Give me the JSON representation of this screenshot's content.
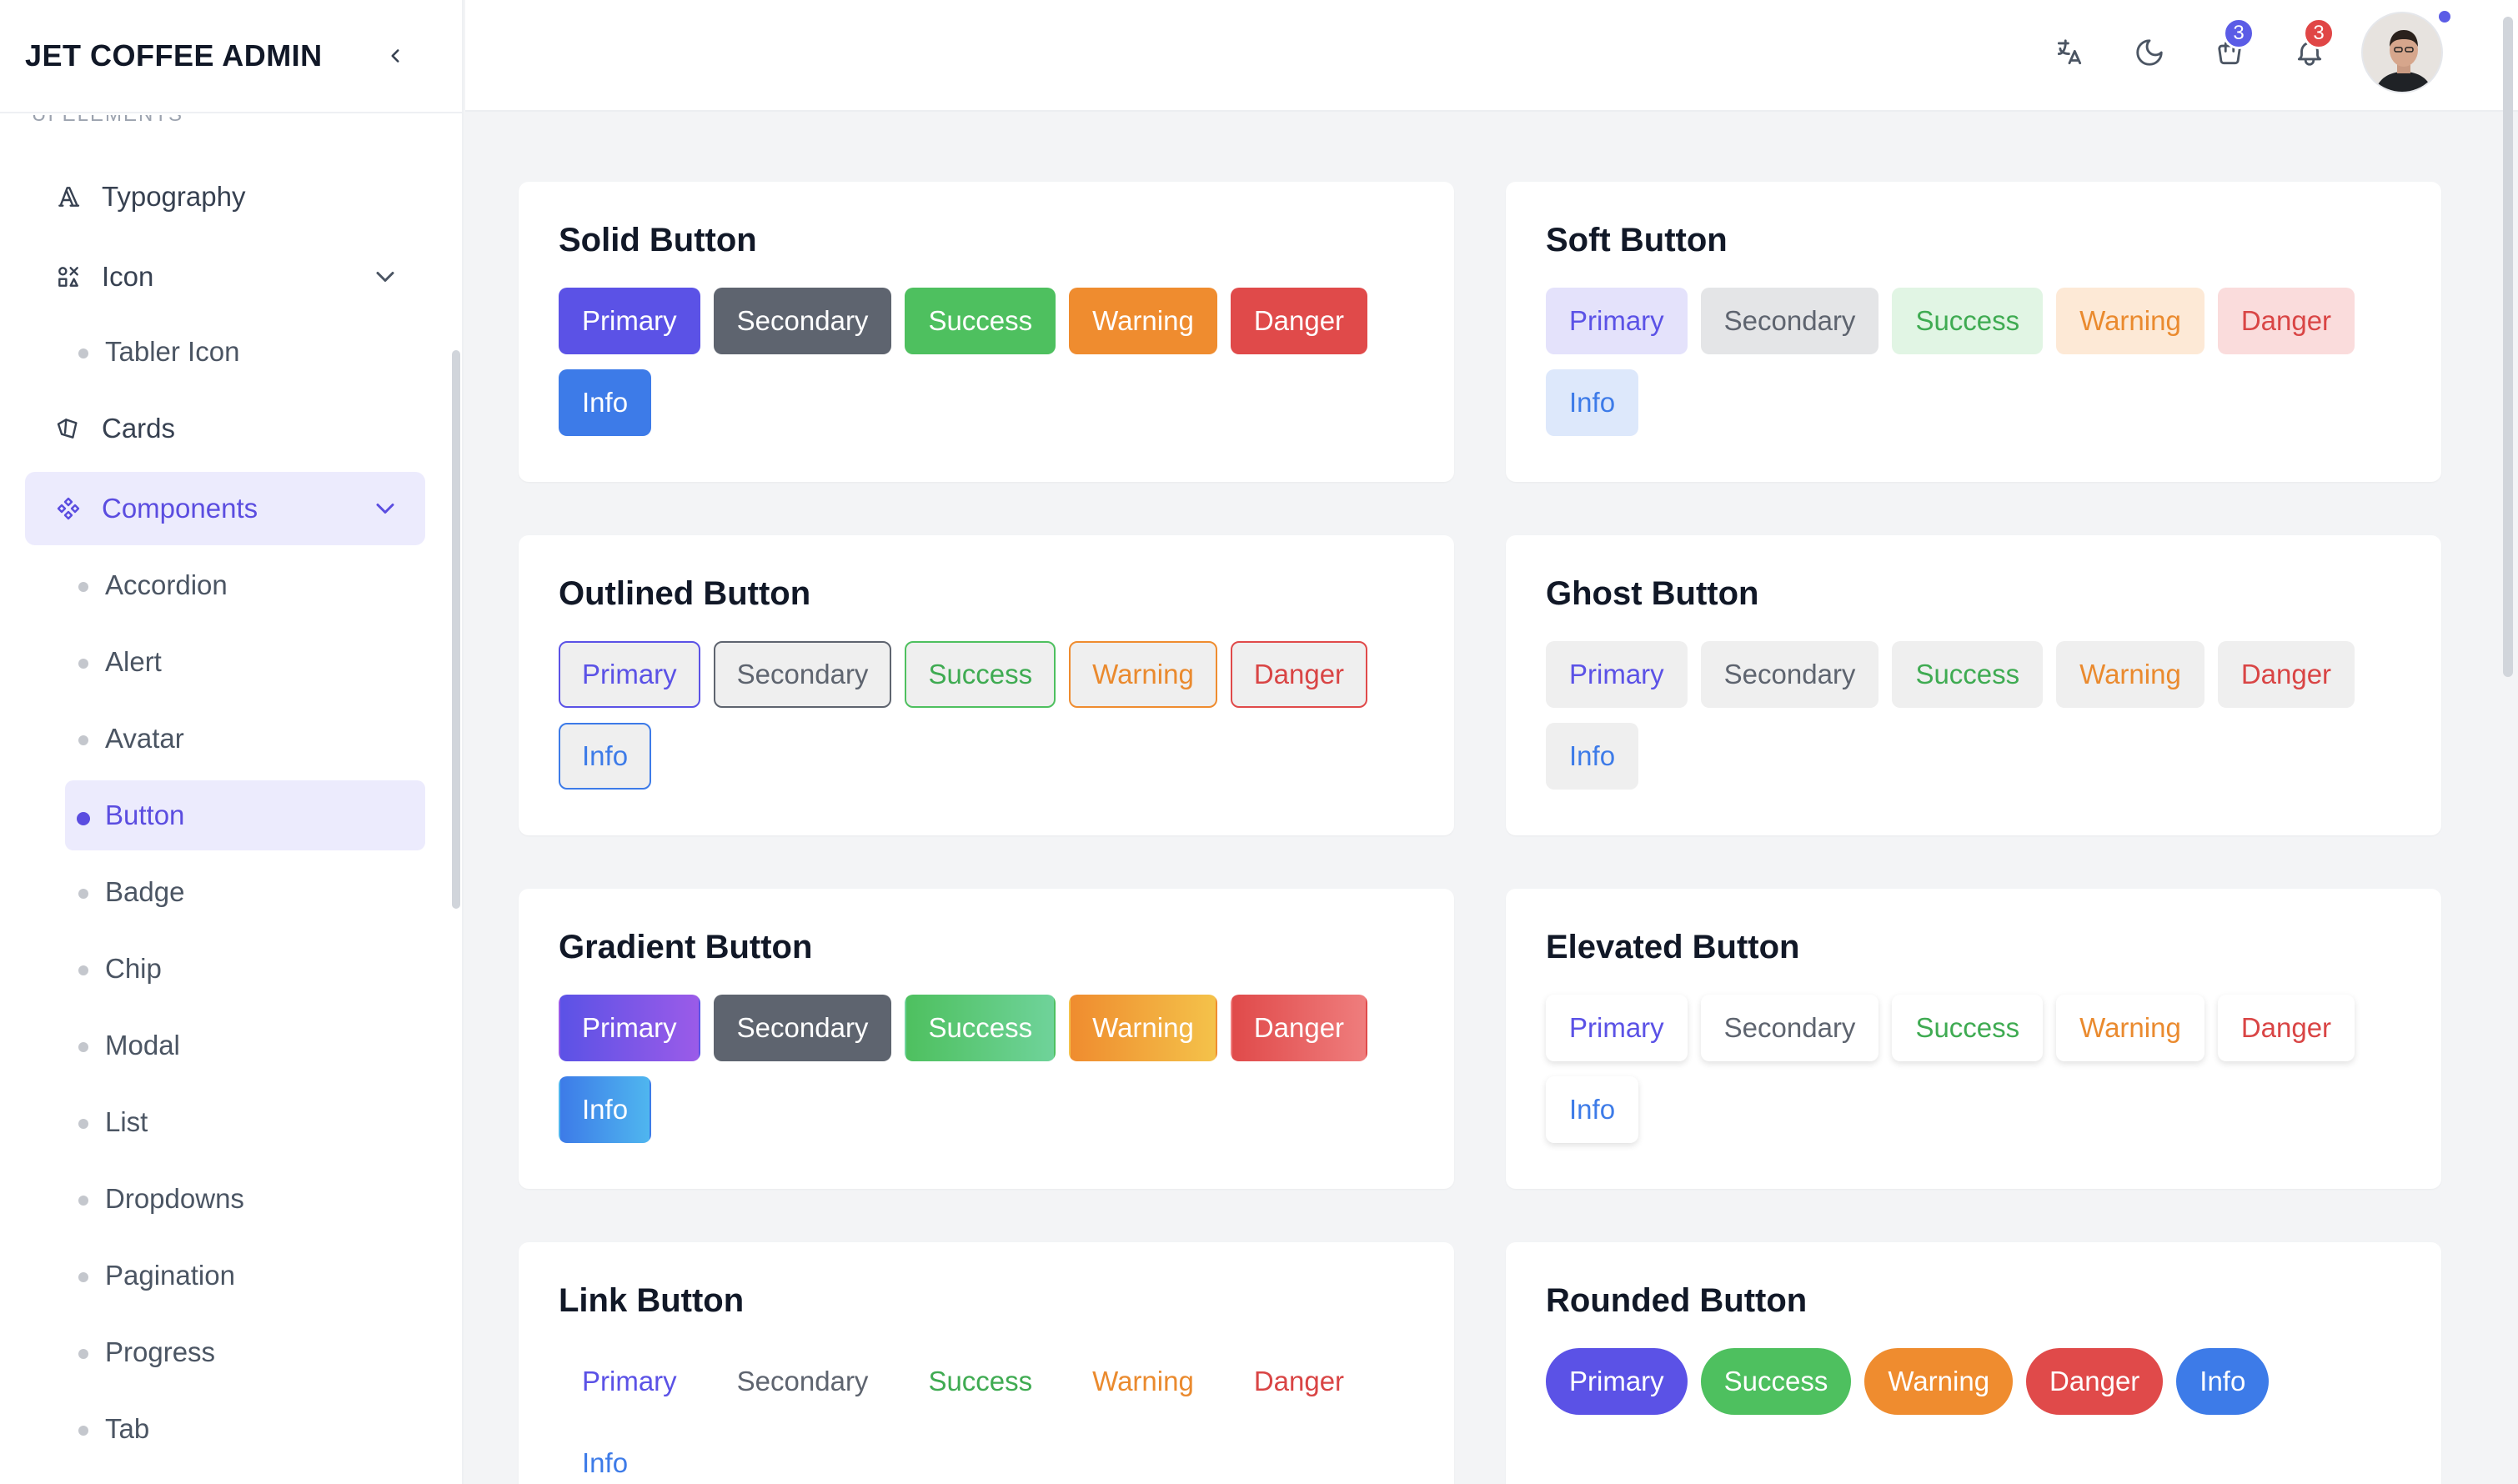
{
  "app": {
    "brand": "JET COFFEE ADMIN"
  },
  "sidebar": {
    "section_label": "UI ELEMENTS",
    "items": [
      {
        "label": "Typography",
        "icon": "typography-icon"
      },
      {
        "label": "Icon",
        "icon": "icons-grid-icon"
      },
      {
        "label": "Tabler Icon"
      },
      {
        "label": "Cards",
        "icon": "cards-icon"
      },
      {
        "label": "Components",
        "icon": "components-icon"
      }
    ],
    "components_sub": [
      "Accordion",
      "Alert",
      "Avatar",
      "Button",
      "Badge",
      "Chip",
      "Modal",
      "List",
      "Dropdowns",
      "Pagination",
      "Progress",
      "Tab"
    ]
  },
  "topbar": {
    "cart_count": "3",
    "notification_count": "3"
  },
  "labels": {
    "primary": "Primary",
    "secondary": "Secondary",
    "success": "Success",
    "warning": "Warning",
    "danger": "Danger",
    "info": "Info"
  },
  "cards": {
    "solid": "Solid Button",
    "soft": "Soft Button",
    "outlined": "Outlined Button",
    "ghost": "Ghost Button",
    "gradient": "Gradient Button",
    "elevated": "Elevated Button",
    "link": "Link Button",
    "rounded": "Rounded Button"
  },
  "colors": {
    "primary": "#5b52e6",
    "secondary": "#5e646f",
    "success": "#4ec05f",
    "warning": "#ef8c2f",
    "danger": "#e04a4a",
    "info": "#3d7be8",
    "active_bg": "#ecebfd"
  }
}
